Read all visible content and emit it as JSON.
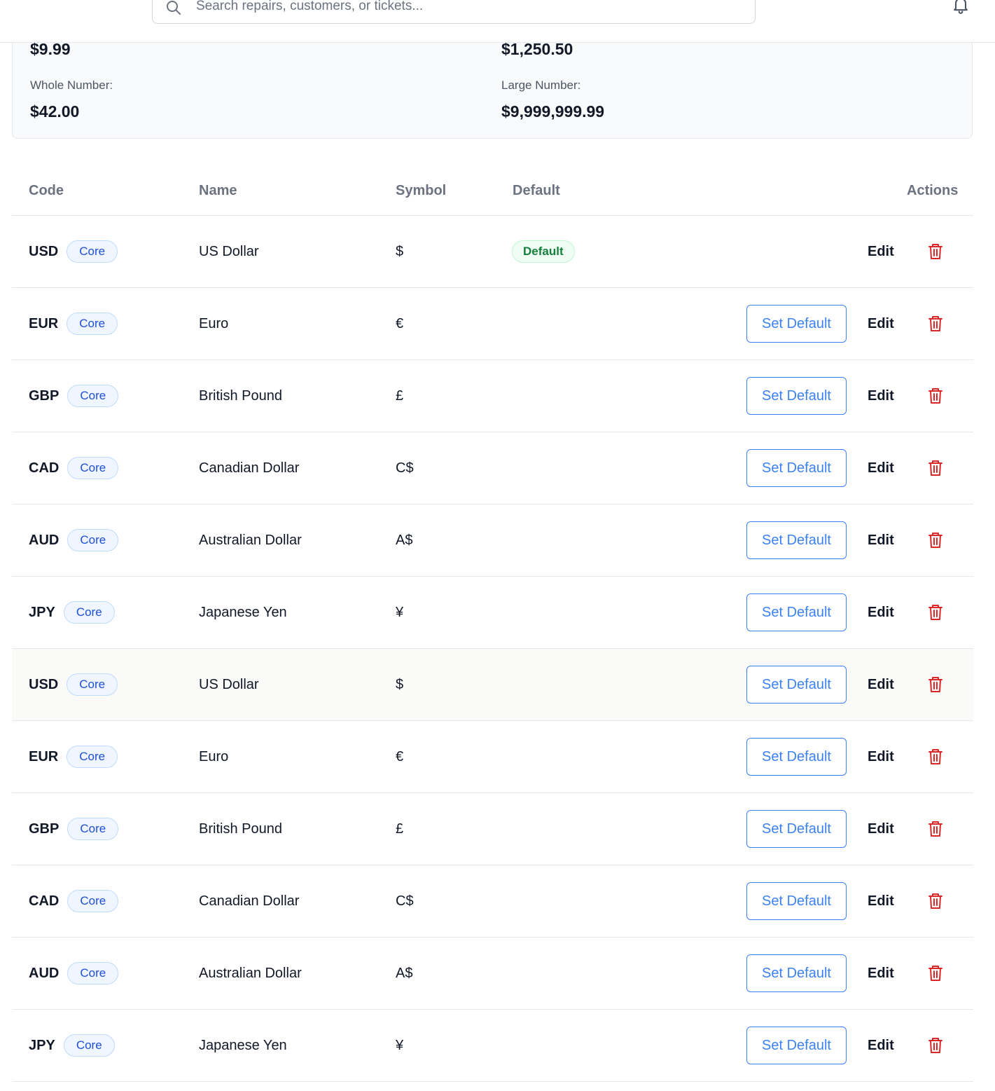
{
  "search": {
    "placeholder": "Search repairs, customers, or tickets..."
  },
  "format_preview": {
    "items": [
      {
        "label": "",
        "value": "$9.99"
      },
      {
        "label": "",
        "value": "$1,250.50"
      },
      {
        "label": "Whole Number:",
        "value": "$42.00"
      },
      {
        "label": "Large Number:",
        "value": "$9,999,999.99"
      }
    ]
  },
  "table": {
    "headers": {
      "code": "Code",
      "name": "Name",
      "symbol": "Symbol",
      "default": "Default",
      "actions": "Actions"
    },
    "rows": [
      {
        "code": "USD",
        "badge": "Core",
        "name": "US Dollar",
        "symbol": "$",
        "default_label": "Default",
        "set_default_label": "",
        "edit_label": "Edit",
        "highlighted": false
      },
      {
        "code": "EUR",
        "badge": "Core",
        "name": "Euro",
        "symbol": "€",
        "default_label": "",
        "set_default_label": "Set Default",
        "edit_label": "Edit",
        "highlighted": false
      },
      {
        "code": "GBP",
        "badge": "Core",
        "name": "British Pound",
        "symbol": "£",
        "default_label": "",
        "set_default_label": "Set Default",
        "edit_label": "Edit",
        "highlighted": false
      },
      {
        "code": "CAD",
        "badge": "Core",
        "name": "Canadian Dollar",
        "symbol": "C$",
        "default_label": "",
        "set_default_label": "Set Default",
        "edit_label": "Edit",
        "highlighted": false
      },
      {
        "code": "AUD",
        "badge": "Core",
        "name": "Australian Dollar",
        "symbol": "A$",
        "default_label": "",
        "set_default_label": "Set Default",
        "edit_label": "Edit",
        "highlighted": false
      },
      {
        "code": "JPY",
        "badge": "Core",
        "name": "Japanese Yen",
        "symbol": "¥",
        "default_label": "",
        "set_default_label": "Set Default",
        "edit_label": "Edit",
        "highlighted": false
      },
      {
        "code": "USD",
        "badge": "Core",
        "name": "US Dollar",
        "symbol": "$",
        "default_label": "",
        "set_default_label": "Set Default",
        "edit_label": "Edit",
        "highlighted": true
      },
      {
        "code": "EUR",
        "badge": "Core",
        "name": "Euro",
        "symbol": "€",
        "default_label": "",
        "set_default_label": "Set Default",
        "edit_label": "Edit",
        "highlighted": false
      },
      {
        "code": "GBP",
        "badge": "Core",
        "name": "British Pound",
        "symbol": "£",
        "default_label": "",
        "set_default_label": "Set Default",
        "edit_label": "Edit",
        "highlighted": false
      },
      {
        "code": "CAD",
        "badge": "Core",
        "name": "Canadian Dollar",
        "symbol": "C$",
        "default_label": "",
        "set_default_label": "Set Default",
        "edit_label": "Edit",
        "highlighted": false
      },
      {
        "code": "AUD",
        "badge": "Core",
        "name": "Australian Dollar",
        "symbol": "A$",
        "default_label": "",
        "set_default_label": "Set Default",
        "edit_label": "Edit",
        "highlighted": false
      },
      {
        "code": "JPY",
        "badge": "Core",
        "name": "Japanese Yen",
        "symbol": "¥",
        "default_label": "",
        "set_default_label": "Set Default",
        "edit_label": "Edit",
        "highlighted": false
      }
    ]
  },
  "icons": {
    "search": "search-icon",
    "notifications": "bell-icon",
    "delete": "trash-icon"
  },
  "colors": {
    "accent": "#3b82f6",
    "danger": "#dc2626",
    "core_badge": "#1d4ed8",
    "default_badge": "#15803d"
  }
}
